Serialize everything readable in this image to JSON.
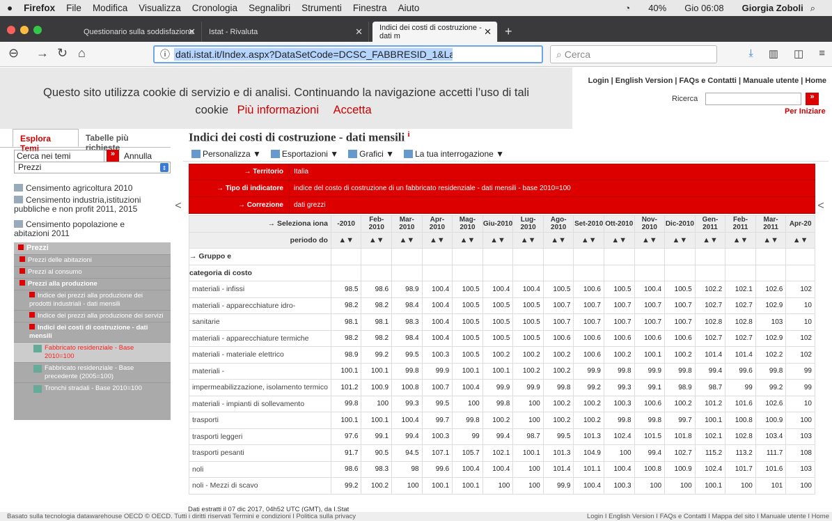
{
  "menubar": {
    "app": "Firefox",
    "items": [
      "File",
      "Modifica",
      "Visualizza",
      "Cronologia",
      "Segnalibri",
      "Strumenti",
      "Finestra",
      "Aiuto"
    ],
    "battery": "40%",
    "time": "Gio 06:08",
    "user": "Giorgia Zoboli"
  },
  "tabs": [
    {
      "label": "Questionario sulla soddisfazione"
    },
    {
      "label": "Istat - Rivaluta"
    },
    {
      "label": "Indici dei costi di costruzione - dati m"
    }
  ],
  "navbar": {
    "url": "dati.istat.it/Index.aspx?DataSetCode=DCSC_FABBRESID_1&Lang",
    "search_placeholder": "Cerca"
  },
  "cookie": {
    "line1": "Questo sito utilizza cookie di servizio e di analisi. Continuando la navigazione accetti l’uso di tali",
    "line2": "cookie",
    "more": "Più informazioni",
    "accept": "Accetta"
  },
  "site": {
    "toplinks": "Login | English Version | FAQs e Contatti | Manuale utente | Home",
    "ricerca": "Ricerca",
    "per_iniziare": "Per Iniziare"
  },
  "sidebar": {
    "tab1": "Esplora Temi",
    "tab2": "Tabelle più richieste",
    "search_value": "Cerca nei temi",
    "annulla": "Annulla",
    "select": "Prezzi",
    "items": [
      "Censimento agricoltura 2010",
      "Censimento industria,istituzioni pubbliche e non profit 2011, 2015",
      "Censimento popolazione e abitazioni 2011"
    ],
    "tree": {
      "header": "Prezzi",
      "abitazioni": "Prezzi delle abitazioni",
      "consumo": "Prezzi al consumo",
      "produzione": "Prezzi alla produzione",
      "ind_prod": "Indice dei prezzi alla produzione dei prodotti industriali - dati mensili",
      "ind_serv": "Indice dei prezzi alla produzione dei servizi",
      "costi": "Indici dei costi di costruzione - dati mensili",
      "fab2010": "Fabbricato residenziale - Base 2010=100",
      "fab2005": "Fabbricato residenziale - Base precedente (2005=100)",
      "tronchi": "Tronchi stradali - Base 2010=100"
    }
  },
  "main": {
    "title": "Indici dei costi di costruzione - dati mensili",
    "title_sup": "i",
    "toolbar": [
      "Personalizza ▼",
      "Esportazioni ▼",
      "Grafici ▼",
      "La tua interrogazione ▼"
    ],
    "territorio_label": "Territorio",
    "territorio": "Italia",
    "tipo_label": "Tipo di indicatore",
    "tipo": "indice del costo di costruzione di un fabbricato residenziale - dati mensili - base 2010=100",
    "correzione_label": "Correzione",
    "correzione": "dati grezzi",
    "seleziona_label": "Seleziona iona",
    "periodo_label": "periodo  do",
    "gruppo_label": "Gruppo e",
    "categoria_label": "categoria di costo",
    "periods": [
      "-2010",
      "Feb-2010",
      "Mar-2010",
      "Apr-2010",
      "Mag-2010",
      "Giu-2010",
      "Lug-2010",
      "Ago-2010",
      "Set-2010",
      "Ott-2010",
      "Nov-2010",
      "Dic-2010",
      "Gen-2011",
      "Feb-2011",
      "Mar-2011",
      "Apr-20"
    ],
    "rows": [
      {
        "cat": "materiali - infissi",
        "vals": [
          "98.5",
          "98.6",
          "98.9",
          "100.4",
          "100.5",
          "100.4",
          "100.4",
          "100.5",
          "100.6",
          "100.5",
          "100.4",
          "100.5",
          "102.2",
          "102.1",
          "102.6",
          "102"
        ]
      },
      {
        "cat": "materiali - apparecchiature idro-",
        "vals": [
          "98.2",
          "98.2",
          "98.4",
          "100.4",
          "100.5",
          "100.5",
          "100.5",
          "100.7",
          "100.7",
          "100.7",
          "100.7",
          "100.7",
          "102.7",
          "102.7",
          "102.9",
          "10"
        ]
      },
      {
        "cat": "sanitarie",
        "vals": [
          "98.1",
          "98.1",
          "98.3",
          "100.4",
          "100.5",
          "100.5",
          "100.5",
          "100.7",
          "100.7",
          "100.7",
          "100.7",
          "100.7",
          "102.8",
          "102.8",
          "103",
          "10"
        ]
      },
      {
        "cat": "materiali - apparecchiature termiche",
        "vals": [
          "98.2",
          "98.2",
          "98.4",
          "100.4",
          "100.5",
          "100.5",
          "100.5",
          "100.6",
          "100.6",
          "100.6",
          "100.6",
          "100.6",
          "102.7",
          "102.7",
          "102.9",
          "102"
        ]
      },
      {
        "cat": "materiali - materiale elettrico",
        "vals": [
          "98.9",
          "99.2",
          "99.5",
          "100.3",
          "100.5",
          "100.2",
          "100.2",
          "100.2",
          "100.6",
          "100.2",
          "100.1",
          "100.2",
          "101.4",
          "101.4",
          "102.2",
          "102"
        ]
      },
      {
        "cat": "materiali -",
        "vals": [
          "100.1",
          "100.1",
          "99.8",
          "99.9",
          "100.1",
          "100.1",
          "100.2",
          "100.2",
          "99.9",
          "99.8",
          "99.9",
          "99.8",
          "99.4",
          "99.6",
          "99.8",
          "99"
        ]
      },
      {
        "cat": "impermeabilizzazione, isolamento termico",
        "vals": [
          "101.2",
          "100.9",
          "100.8",
          "100.7",
          "100.4",
          "99.9",
          "99.9",
          "99.8",
          "99.2",
          "99.3",
          "99.1",
          "98.9",
          "98.7",
          "99",
          "99.2",
          "99"
        ]
      },
      {
        "cat": "materiali - impianti di sollevamento",
        "vals": [
          "99.8",
          "100",
          "99.3",
          "99.5",
          "100",
          "99.8",
          "100",
          "100.2",
          "100.2",
          "100.3",
          "100.6",
          "100.2",
          "101.2",
          "101.6",
          "102.6",
          "10"
        ]
      },
      {
        "cat": "trasporti",
        "vals": [
          "100.1",
          "100.1",
          "100.4",
          "99.7",
          "99.8",
          "100.2",
          "100",
          "100.2",
          "100.2",
          "99.8",
          "99.8",
          "99.7",
          "100.1",
          "100.8",
          "100.9",
          "100"
        ]
      },
      {
        "cat": "trasporti leggeri",
        "vals": [
          "97.6",
          "99.1",
          "99.4",
          "100.3",
          "99",
          "99.4",
          "98.7",
          "99.5",
          "101.3",
          "102.4",
          "101.5",
          "101.8",
          "102.1",
          "102.8",
          "103.4",
          "103"
        ]
      },
      {
        "cat": "trasporti pesanti",
        "vals": [
          "91.7",
          "90.5",
          "94.5",
          "107.1",
          "105.7",
          "102.1",
          "100.1",
          "101.3",
          "104.9",
          "100",
          "99.4",
          "102.7",
          "115.2",
          "113.2",
          "111.7",
          "108"
        ]
      },
      {
        "cat": "noli",
        "vals": [
          "98.6",
          "98.3",
          "98",
          "99.6",
          "100.4",
          "100.4",
          "100",
          "101.4",
          "101.1",
          "100.4",
          "100.8",
          "100.9",
          "102.4",
          "101.7",
          "101.6",
          "103"
        ]
      },
      {
        "cat": "noli - Mezzi di scavo",
        "vals": [
          "99.2",
          "100.2",
          "100",
          "100.1",
          "100.1",
          "100",
          "100",
          "99.9",
          "100.4",
          "100.3",
          "100",
          "100",
          "100.1",
          "100",
          "101",
          "100"
        ]
      }
    ]
  },
  "footer": {
    "extract": "Dati estratti il 07 dic 2017, 04h52 UTC (GMT), da I.Stat",
    "left": "Basato sulla tecnologia datawarehouse OECD © OECD. Tutti i diritti riservati Termini e condizioni  I  Politica sulla privacy",
    "right": "Login I English Version I FAQs e Contatti I Mappa del sito I Manuale utente I Home"
  }
}
